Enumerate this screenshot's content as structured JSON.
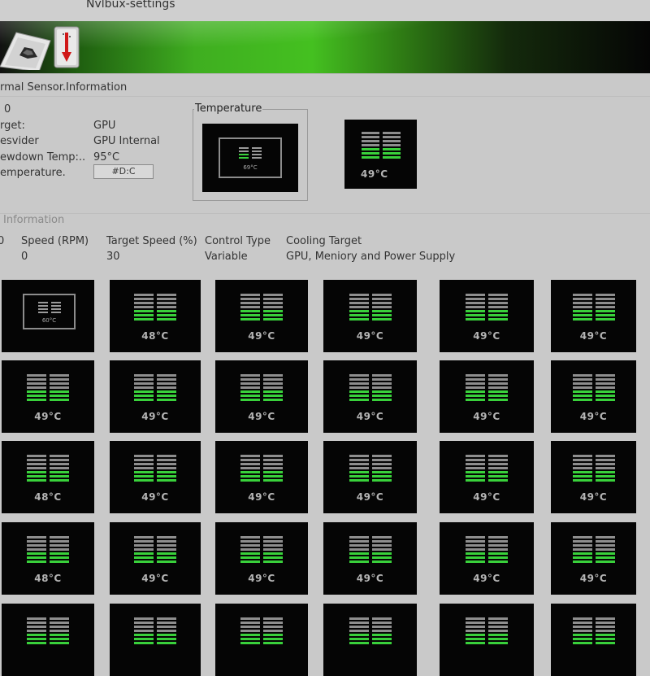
{
  "window": {
    "title": "Nvlbux-settings"
  },
  "thermal": {
    "section_title": "rmal Sensor.Information",
    "id_value": "0",
    "rows": [
      {
        "label": "rget:",
        "value": "GPU"
      },
      {
        "label": "esvider",
        "value": "GPU Internal"
      },
      {
        "label": "ewdown Temp:..",
        "value": "95°C"
      },
      {
        "label": "emperature.",
        "value": "#D:C"
      }
    ],
    "group_title": "Temperature",
    "preview_temp": "69°C",
    "big_temp": "49°C"
  },
  "fan": {
    "section_title": "Information",
    "headers": [
      "0",
      "Speed (RPM)",
      "Target Speed (%)",
      "Control Type",
      "Cooling Target"
    ],
    "values": [
      "0",
      "30",
      "Variable",
      "GPU, Meniory and Power Supply"
    ]
  },
  "tiles": [
    [
      "60°C",
      "48°C",
      "49°C",
      "49°C",
      "49°C",
      "49°C"
    ],
    [
      "49°C",
      "49°C",
      "49°C",
      "49°C",
      "49°C",
      "49°C"
    ],
    [
      "48°C",
      "49°C",
      "49°C",
      "49°C",
      "49°C",
      "49°C"
    ],
    [
      "48°C",
      "49°C",
      "49°C",
      "49°C",
      "49°C",
      "49°C"
    ],
    [
      "",
      "",
      "",
      "",
      "",
      ""
    ]
  ],
  "colors": {
    "accent_green": "#39d13b",
    "bar_gray": "#8e8e8e",
    "tile_bg": "#050505"
  },
  "icons": {
    "logo": "nvidia-badge-icon",
    "thermometer": "thermometer-icon"
  }
}
